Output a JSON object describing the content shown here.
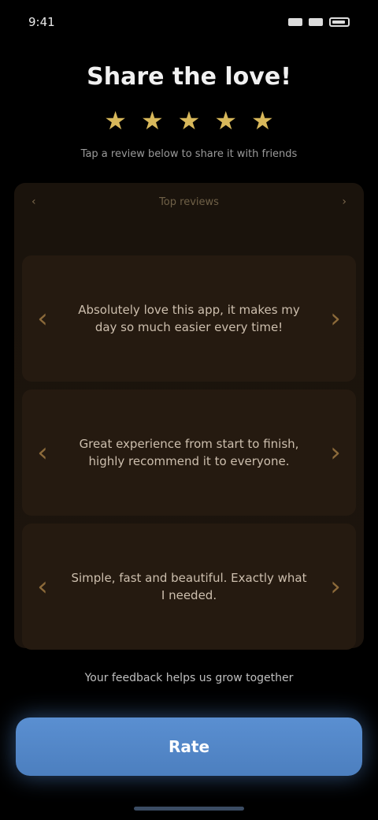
{
  "status": {
    "time": "9:41"
  },
  "header": {
    "title": "Share the love!",
    "subtitle": "Tap a review below to share it with friends"
  },
  "rating": {
    "stars": 5,
    "icon": "star-icon",
    "color": "#d8b85b"
  },
  "panel": {
    "left_label": "‹",
    "center_label": "Top reviews",
    "right_label": "›"
  },
  "reviews": [
    {
      "text": "Absolutely love this app, it makes my day so much easier every time!"
    },
    {
      "text": "Great experience from start to finish, highly recommend it to everyone."
    },
    {
      "text": "Simple, fast and beautiful. Exactly what I needed."
    }
  ],
  "footer": {
    "hint": "Your feedback helps us grow together",
    "button_label": "Rate"
  },
  "colors": {
    "accent": "#5a8fd1",
    "panel": "#1a130c",
    "card": "#251a10"
  }
}
